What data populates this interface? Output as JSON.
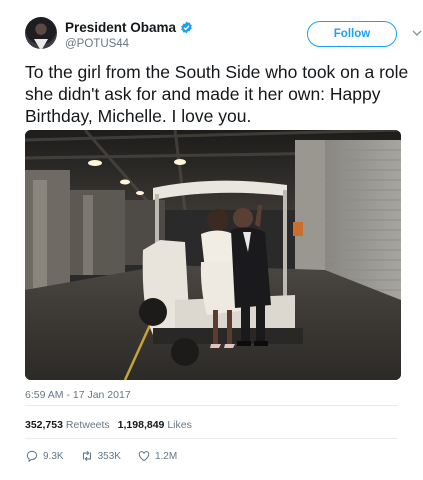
{
  "tweet": {
    "display_name": "President Obama",
    "handle": "@POTUS44",
    "follow_label": "Follow",
    "text": "To the girl from the South Side who took on a role she didn't ask for and made it her own: Happy Birthday, Michelle. I love you.",
    "timestamp": "6:59 AM - 17 Jan 2017",
    "retweets_count": "352,753",
    "retweets_label": "Retweets",
    "likes_count": "1,198,849",
    "likes_label": "Likes",
    "reply_count": "9.3K",
    "retweet_action_count": "353K",
    "like_action_count": "1.2M"
  },
  "colors": {
    "accent": "#1da1f2",
    "muted": "#657786",
    "text": "#14171a"
  },
  "icons": [
    "verified-badge-icon",
    "chevron-down-icon",
    "reply-icon",
    "retweet-icon",
    "heart-icon"
  ]
}
